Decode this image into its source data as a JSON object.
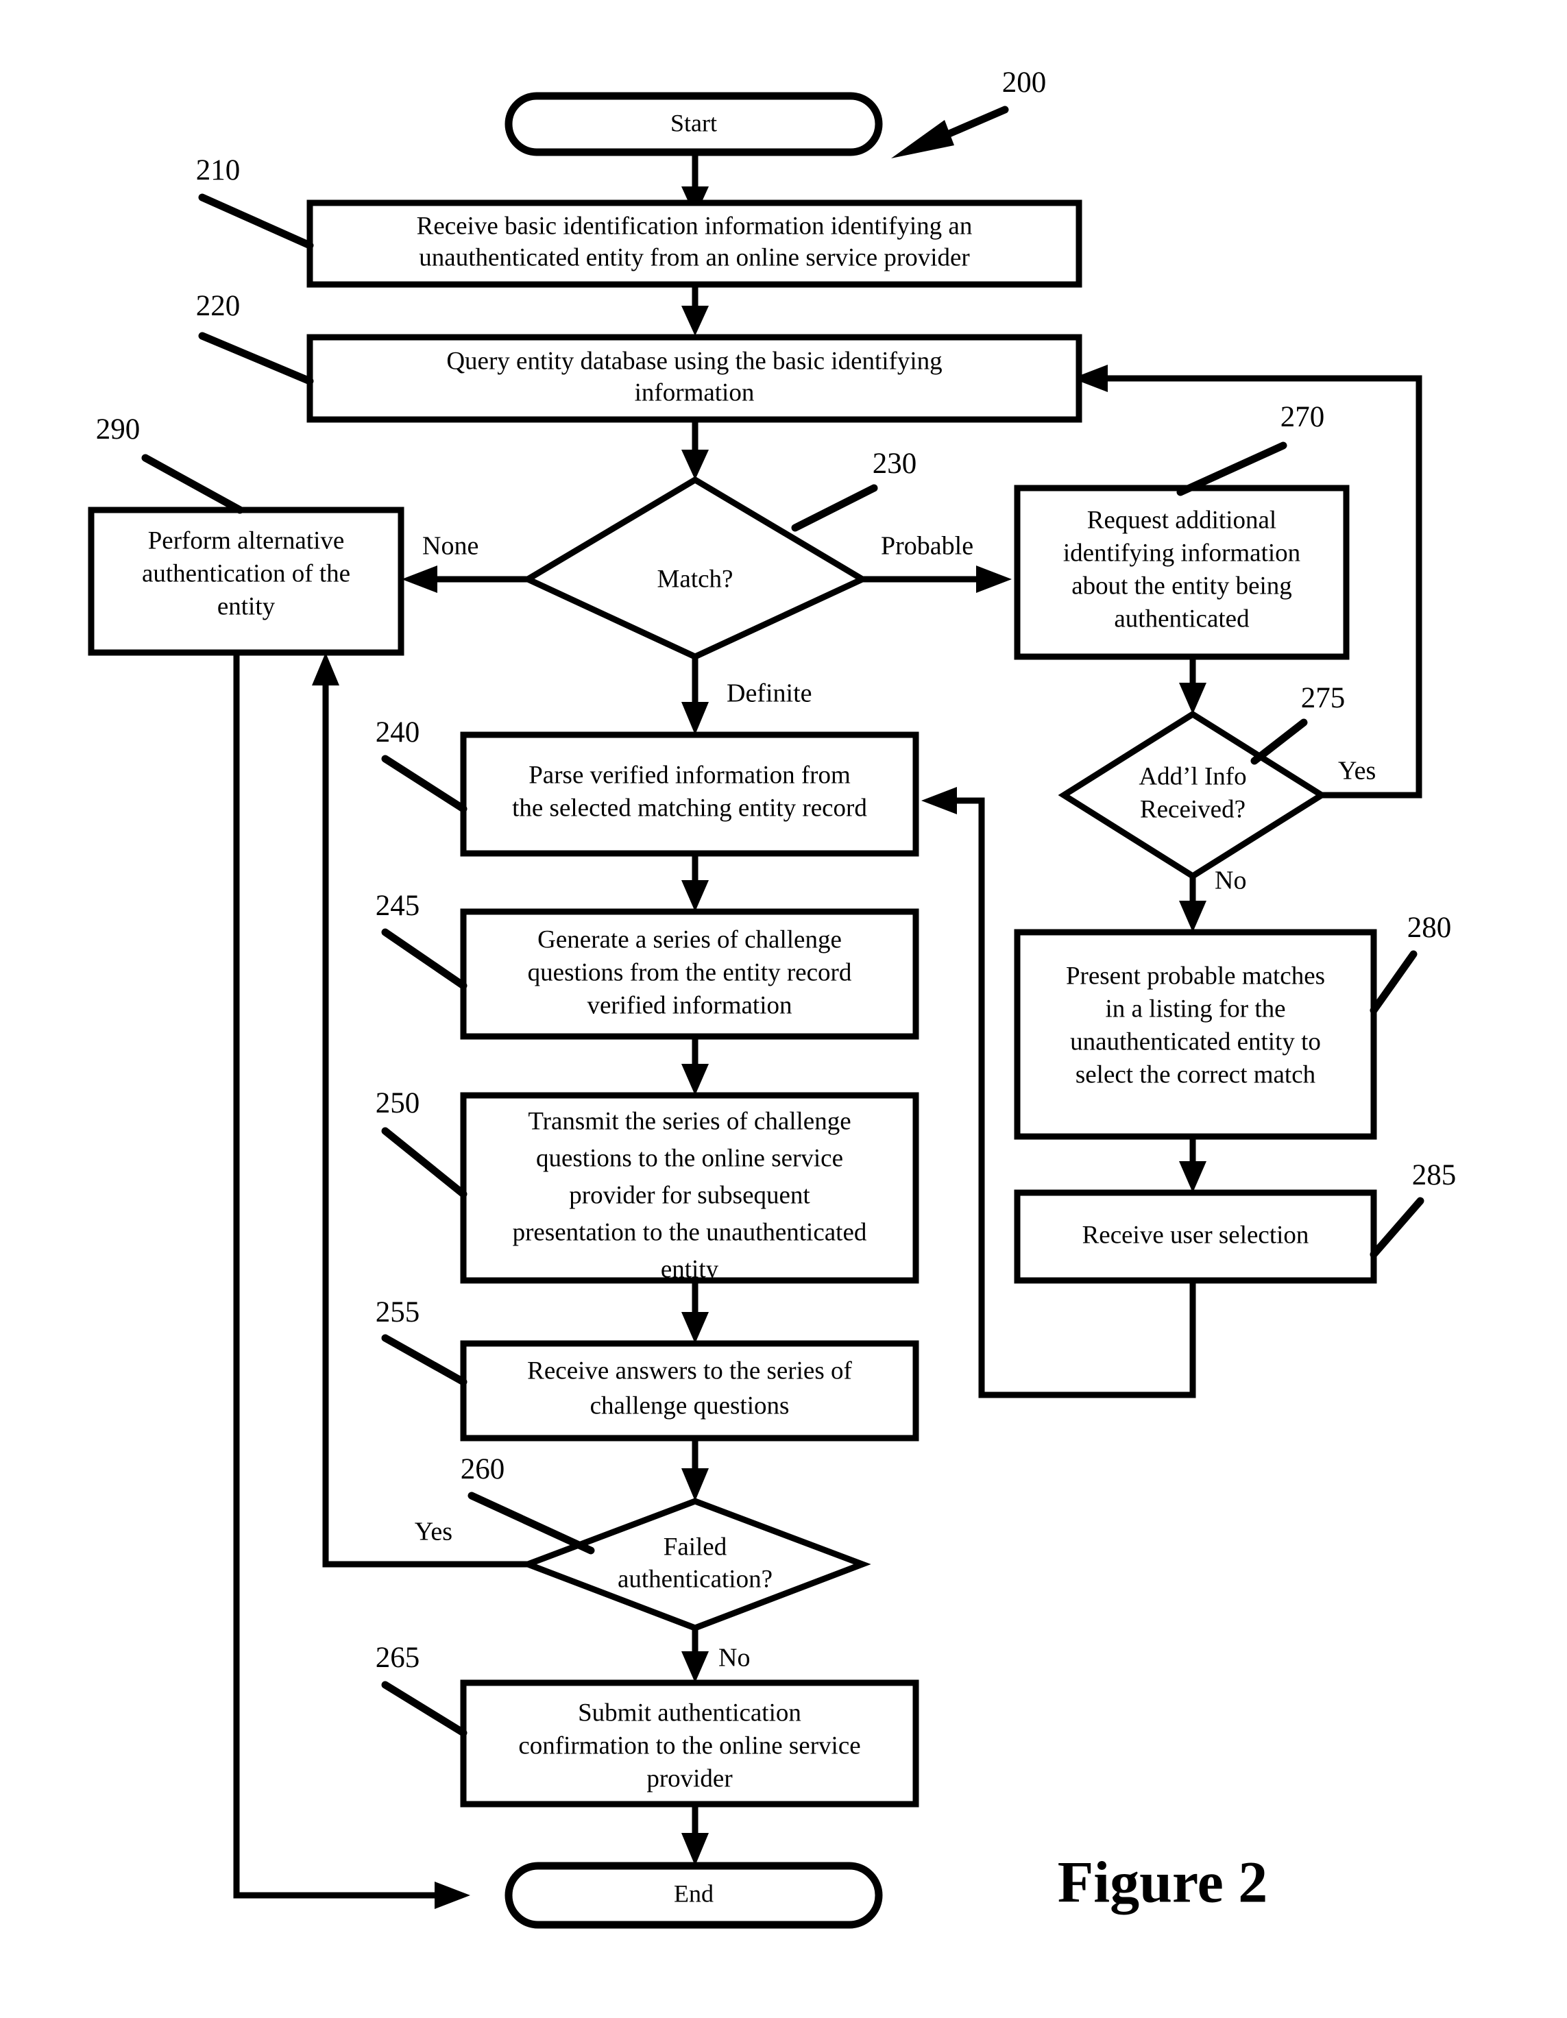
{
  "figure": {
    "caption": "Figure 2",
    "diagram_number": "200",
    "type": "flowchart"
  },
  "terminators": {
    "start": "Start",
    "end": "End"
  },
  "nodes": [
    {
      "ref": "210",
      "shape": "process",
      "lines": [
        "Receive basic identification information identifying an",
        "unauthenticated entity from an online service provider"
      ]
    },
    {
      "ref": "220",
      "shape": "process",
      "lines": [
        "Query entity database using the basic identifying",
        "information"
      ]
    },
    {
      "ref": "230",
      "shape": "decision",
      "lines": [
        "Match?"
      ]
    },
    {
      "ref": "240",
      "shape": "process",
      "lines": [
        "Parse verified information from",
        "the selected matching entity record"
      ]
    },
    {
      "ref": "245",
      "shape": "process",
      "lines": [
        "Generate a series of challenge",
        "questions from the entity record",
        "verified information"
      ]
    },
    {
      "ref": "250",
      "shape": "process",
      "lines": [
        "Transmit the series of challenge",
        "questions to the online service",
        "provider for subsequent",
        "presentation to the unauthenticated",
        "entity"
      ]
    },
    {
      "ref": "255",
      "shape": "process",
      "lines": [
        "Receive answers to the series of",
        "challenge questions"
      ]
    },
    {
      "ref": "260",
      "shape": "decision",
      "lines": [
        "Failed",
        "authentication?"
      ]
    },
    {
      "ref": "265",
      "shape": "process",
      "lines": [
        "Submit authentication",
        "confirmation to the online service",
        "provider"
      ]
    },
    {
      "ref": "270",
      "shape": "process",
      "lines": [
        "Request additional",
        "identifying information",
        "about the entity being",
        "authenticated"
      ]
    },
    {
      "ref": "275",
      "shape": "decision",
      "lines": [
        "Add’l Info",
        "Received?"
      ]
    },
    {
      "ref": "280",
      "shape": "process",
      "lines": [
        "Present probable matches",
        "in a listing for the",
        "unauthenticated entity to",
        "select the correct match"
      ]
    },
    {
      "ref": "285",
      "shape": "process",
      "lines": [
        "Receive user selection"
      ]
    },
    {
      "ref": "290",
      "shape": "process",
      "lines": [
        "Perform alternative",
        "authentication of the",
        "entity"
      ]
    }
  ],
  "edge_labels": {
    "match_none": "None",
    "match_probable": "Probable",
    "match_definite": "Definite",
    "addl_info_yes": "Yes",
    "addl_info_no": "No",
    "failed_auth_yes": "Yes",
    "failed_auth_no": "No"
  },
  "colors": {
    "stroke": "#000000",
    "fill": "#ffffff",
    "background": "#ffffff"
  }
}
